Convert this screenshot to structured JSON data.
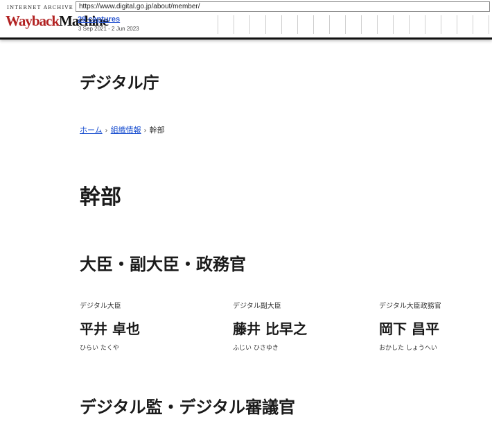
{
  "wayback": {
    "logo_top": "INTERNET ARCHIVE",
    "logo_word1": "Wayback",
    "logo_word2": "Machine",
    "url": "https://www.digital.go.jp/about/member/",
    "captures": "29 captures",
    "date_range": "3 Sep 2021 - 2 Jun 2023"
  },
  "site": {
    "title": "デジタル庁"
  },
  "breadcrumb": {
    "items": [
      {
        "label": "ホーム"
      },
      {
        "label": "組織情報"
      },
      {
        "label": "幹部"
      }
    ],
    "separator": "›"
  },
  "page": {
    "title": "幹部"
  },
  "sections": [
    {
      "title": "大臣・副大臣・政務官",
      "members": [
        {
          "role": "デジタル大臣",
          "name": "平井 卓也",
          "reading": "ひらい たくや"
        },
        {
          "role": "デジタル副大臣",
          "name": "藤井 比早之",
          "reading": "ふじい ひさゆき"
        },
        {
          "role": "デジタル大臣政務官",
          "name": "岡下 昌平",
          "reading": "おかした しょうへい"
        }
      ]
    },
    {
      "title": "デジタル監・デジタル審議官"
    }
  ]
}
